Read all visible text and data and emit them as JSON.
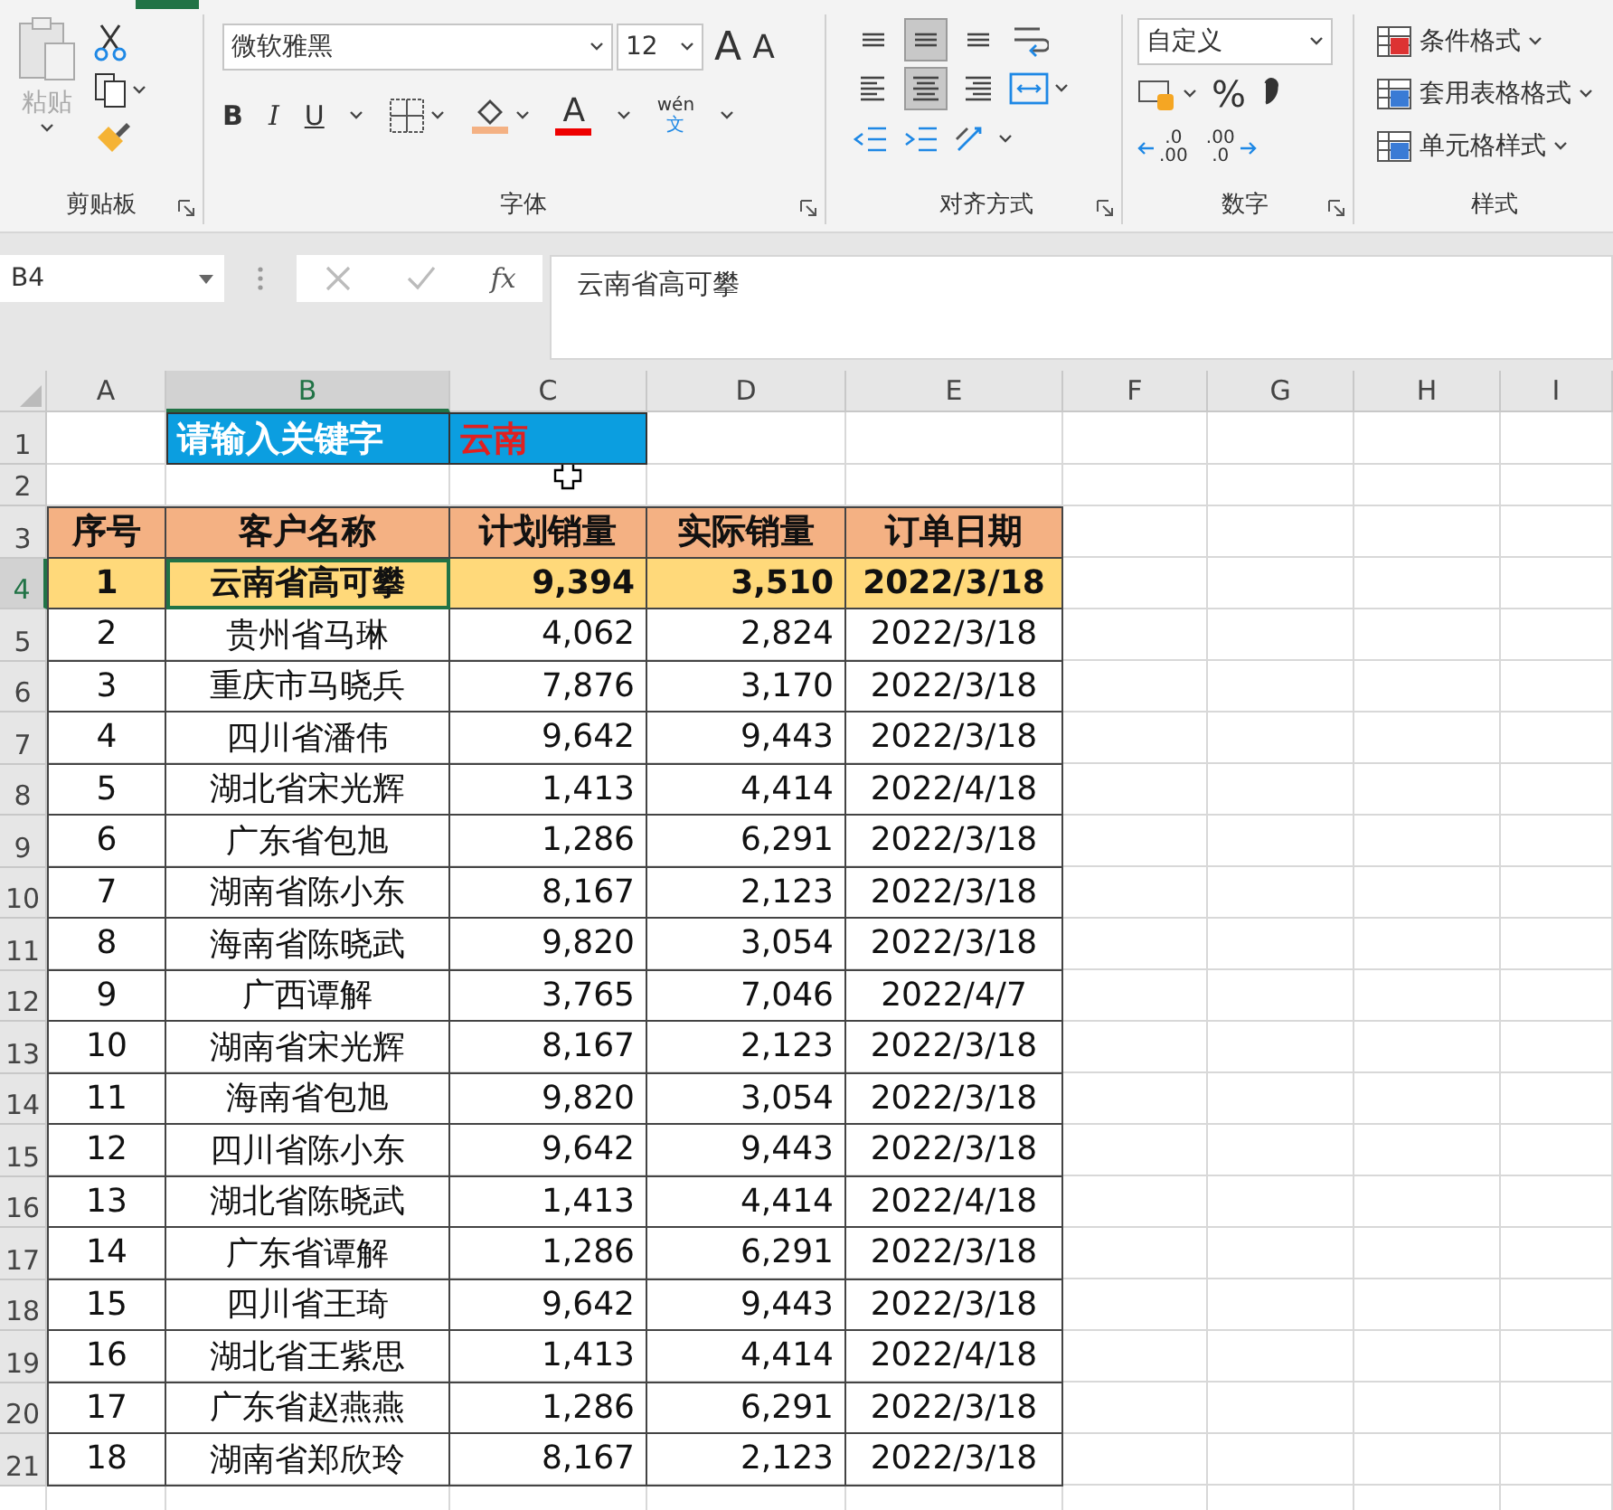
{
  "ribbon": {
    "clipboard": {
      "paste_label": "粘贴",
      "group_label": "剪贴板"
    },
    "font": {
      "font_name": "微软雅黑",
      "font_size": "12",
      "grow_font": "A",
      "shrink_font": "A",
      "bold_label": "B",
      "italic_label": "I",
      "underline_label": "U",
      "font_color_label": "A",
      "phonetic_top": "wén",
      "phonetic_bottom": "文",
      "group_label": "字体"
    },
    "alignment": {
      "buttons": [
        {
          "kind": "top",
          "selected": false
        },
        {
          "kind": "middle",
          "selected": true
        },
        {
          "kind": "bottom",
          "selected": false
        },
        {
          "kind": "left",
          "selected": false
        },
        {
          "kind": "center",
          "selected": true
        },
        {
          "kind": "right",
          "selected": false
        }
      ],
      "group_label": "对齐方式"
    },
    "number": {
      "format": "自定义",
      "percent": "%",
      "decrease_decimal": [
        ".0",
        ".00"
      ],
      "increase_decimal": [
        ".00",
        ".0"
      ],
      "group_label": "数字"
    },
    "styles": {
      "items": [
        "条件格式",
        "套用表格格式",
        "单元格样式"
      ],
      "group_label": "样式"
    }
  },
  "formula_bar": {
    "name_box": "B4",
    "fx": "fx",
    "content": "云南省高可攀"
  },
  "sheet": {
    "columns": [
      {
        "label": "A",
        "selected": false
      },
      {
        "label": "B",
        "selected": true
      },
      {
        "label": "C",
        "selected": false
      },
      {
        "label": "D",
        "selected": false
      },
      {
        "label": "E",
        "selected": false
      },
      {
        "label": "F",
        "selected": false
      },
      {
        "label": "G",
        "selected": false
      },
      {
        "label": "H",
        "selected": false
      },
      {
        "label": "I",
        "selected": false
      }
    ],
    "row_numbers": [
      "1",
      "2",
      "3",
      "4",
      "5",
      "6",
      "7",
      "8",
      "9",
      "10",
      "11",
      "12",
      "13",
      "14",
      "15",
      "16",
      "17",
      "18",
      "19",
      "20",
      "21"
    ],
    "keyword_label": "请输入关键字",
    "keyword_value": "云南",
    "table_headers": [
      "序号",
      "客户名称",
      "计划销量",
      "实际销量",
      "订单日期"
    ],
    "rows": [
      {
        "no": "1",
        "name": "云南省高可攀",
        "plan": "9,394",
        "actual": "3,510",
        "date": "2022/3/18",
        "highlighted": true
      },
      {
        "no": "2",
        "name": "贵州省马琳",
        "plan": "4,062",
        "actual": "2,824",
        "date": "2022/3/18",
        "highlighted": false
      },
      {
        "no": "3",
        "name": "重庆市马晓兵",
        "plan": "7,876",
        "actual": "3,170",
        "date": "2022/3/18",
        "highlighted": false
      },
      {
        "no": "4",
        "name": "四川省潘伟",
        "plan": "9,642",
        "actual": "9,443",
        "date": "2022/3/18",
        "highlighted": false
      },
      {
        "no": "5",
        "name": "湖北省宋光辉",
        "plan": "1,413",
        "actual": "4,414",
        "date": "2022/4/18",
        "highlighted": false
      },
      {
        "no": "6",
        "name": "广东省包旭",
        "plan": "1,286",
        "actual": "6,291",
        "date": "2022/3/18",
        "highlighted": false
      },
      {
        "no": "7",
        "name": "湖南省陈小东",
        "plan": "8,167",
        "actual": "2,123",
        "date": "2022/3/18",
        "highlighted": false
      },
      {
        "no": "8",
        "name": "海南省陈晓武",
        "plan": "9,820",
        "actual": "3,054",
        "date": "2022/3/18",
        "highlighted": false
      },
      {
        "no": "9",
        "name": "广西谭解",
        "plan": "3,765",
        "actual": "7,046",
        "date": "2022/4/7",
        "highlighted": false
      },
      {
        "no": "10",
        "name": "湖南省宋光辉",
        "plan": "8,167",
        "actual": "2,123",
        "date": "2022/3/18",
        "highlighted": false
      },
      {
        "no": "11",
        "name": "海南省包旭",
        "plan": "9,820",
        "actual": "3,054",
        "date": "2022/3/18",
        "highlighted": false
      },
      {
        "no": "12",
        "name": "四川省陈小东",
        "plan": "9,642",
        "actual": "9,443",
        "date": "2022/3/18",
        "highlighted": false
      },
      {
        "no": "13",
        "name": "湖北省陈晓武",
        "plan": "1,413",
        "actual": "4,414",
        "date": "2022/4/18",
        "highlighted": false
      },
      {
        "no": "14",
        "name": "广东省谭解",
        "plan": "1,286",
        "actual": "6,291",
        "date": "2022/3/18",
        "highlighted": false
      },
      {
        "no": "15",
        "name": "四川省王琦",
        "plan": "9,642",
        "actual": "9,443",
        "date": "2022/3/18",
        "highlighted": false
      },
      {
        "no": "16",
        "name": "湖北省王紫思",
        "plan": "1,413",
        "actual": "4,414",
        "date": "2022/4/18",
        "highlighted": false
      },
      {
        "no": "17",
        "name": "广东省赵燕燕",
        "plan": "1,286",
        "actual": "6,291",
        "date": "2022/3/18",
        "highlighted": false
      },
      {
        "no": "18",
        "name": "湖南省郑欣玲",
        "plan": "8,167",
        "actual": "2,123",
        "date": "2022/3/18",
        "highlighted": false
      }
    ]
  }
}
